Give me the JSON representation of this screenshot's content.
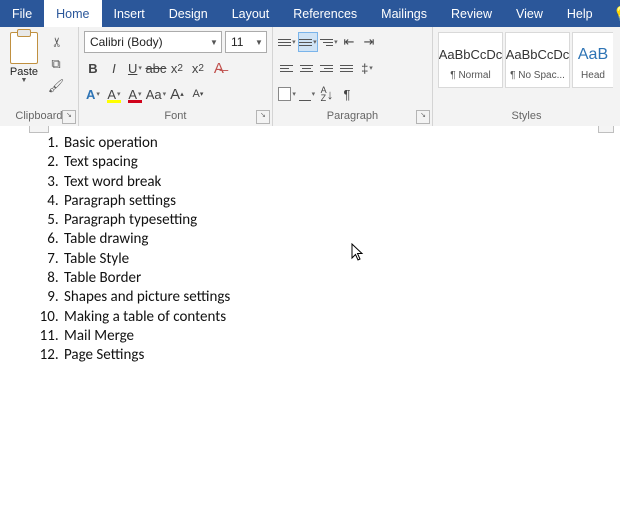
{
  "tabs": {
    "file": "File",
    "home": "Home",
    "insert": "Insert",
    "design": "Design",
    "layout": "Layout",
    "references": "References",
    "mailings": "Mailings",
    "review": "Review",
    "view": "View",
    "help": "Help"
  },
  "clipboard": {
    "paste": "Paste",
    "label": "Clipboard"
  },
  "font": {
    "name": "Calibri (Body)",
    "size": "11",
    "label": "Font",
    "bold": "B",
    "italic": "I",
    "underline": "U",
    "strike": "abc",
    "sub": "x",
    "sup": "x",
    "caseA": "Aa",
    "bigA": "A",
    "smallA": "A",
    "colorA": "A",
    "highlightA": "A",
    "styleA": "A",
    "grow": "A",
    "shrink": "A",
    "sub2": "2",
    "sup2": "2"
  },
  "para": {
    "label": "Paragraph",
    "sortAZ": "A",
    "pilcrow": "¶"
  },
  "styles": {
    "label": "Styles",
    "s1": {
      "preview": "AaBbCcDc",
      "name": "¶ Normal"
    },
    "s2": {
      "preview": "AaBbCcDc",
      "name": "¶ No Spac..."
    },
    "s3": {
      "preview": "AaB",
      "name": "Head"
    }
  },
  "list": [
    "Basic operation",
    "Text spacing",
    "Text word break",
    "Paragraph settings",
    "Paragraph typesetting",
    "Table drawing",
    "Table Style",
    "Table Border",
    "Shapes and picture settings",
    "Making a table of contents",
    "Mail Merge",
    "Page Settings"
  ]
}
